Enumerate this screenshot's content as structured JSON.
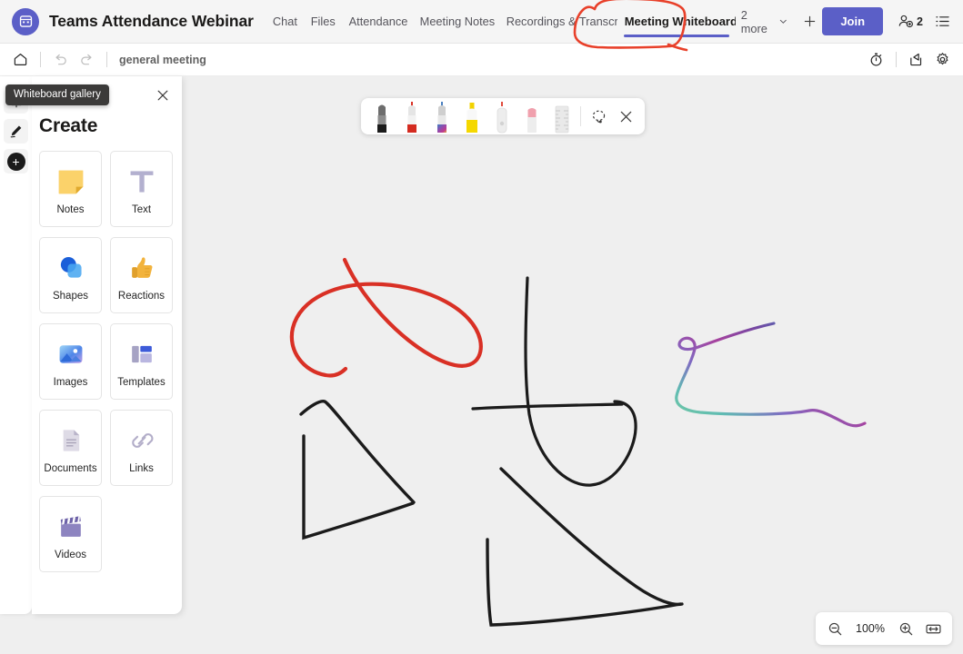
{
  "header": {
    "app_icon": "teams-calendar-icon",
    "title": "Teams Attendance Webinar",
    "tabs": [
      {
        "label": "Chat",
        "active": false
      },
      {
        "label": "Files",
        "active": false
      },
      {
        "label": "Attendance",
        "active": false
      },
      {
        "label": "Meeting Notes",
        "active": false
      },
      {
        "label": "Recordings & Transcr...",
        "active": false
      },
      {
        "label": "Meeting Whiteboard",
        "active": true
      }
    ],
    "more_label": "2 more",
    "add_tab_label": "+",
    "join_label": "Join",
    "people_count": "2",
    "accent_color": "#5b5fc7",
    "annotation_color": "#e8402a"
  },
  "subbar": {
    "home_icon": "home-icon",
    "undo_icon": "undo-icon",
    "redo_icon": "redo-icon",
    "board_name": "general meeting",
    "timer_icon": "timer-icon",
    "share_icon": "share-icon",
    "settings_icon": "settings-gear-icon"
  },
  "rail": {
    "tooltip": "Whiteboard gallery",
    "items": [
      {
        "name": "gallery-button",
        "icon": "whiteboard-gallery-icon"
      },
      {
        "name": "ink-button",
        "icon": "pen-icon"
      },
      {
        "name": "create-button",
        "icon": "plus-icon"
      }
    ]
  },
  "panel": {
    "title": "Create",
    "close_label": "✕",
    "cards": [
      {
        "label": "Notes",
        "icon": "sticky-note-icon"
      },
      {
        "label": "Text",
        "icon": "text-t-icon"
      },
      {
        "label": "Shapes",
        "icon": "shapes-icon"
      },
      {
        "label": "Reactions",
        "icon": "thumbs-up-icon"
      },
      {
        "label": "Images",
        "icon": "image-icon"
      },
      {
        "label": "Templates",
        "icon": "templates-icon"
      },
      {
        "label": "Documents",
        "icon": "document-icon"
      },
      {
        "label": "Links",
        "icon": "link-chain-icon"
      },
      {
        "label": "Videos",
        "icon": "video-clapperboard-icon"
      }
    ]
  },
  "pen_toolbar": {
    "tools": [
      {
        "name": "black-pen",
        "color": "#1b1b1b"
      },
      {
        "name": "red-pen",
        "color": "#d93025"
      },
      {
        "name": "galaxy-pen",
        "color": "#7b4fb5"
      },
      {
        "name": "yellow-highlighter",
        "color": "#f2d200"
      },
      {
        "name": "eraser",
        "color": "#d8d8d8"
      },
      {
        "name": "pink-marker",
        "color": "#f0a0ad"
      },
      {
        "name": "ruler",
        "color": "#dcdcdc"
      }
    ],
    "lasso_icon": "lasso-select-icon",
    "close_icon": "close-icon"
  },
  "zoom_controls": {
    "zoom_out_icon": "zoom-out-icon",
    "value": "100%",
    "zoom_in_icon": "zoom-in-icon",
    "fit_icon": "fit-to-screen-icon"
  },
  "canvas": {
    "background": "#efefef",
    "strokes": [
      {
        "name": "red-loop-stroke",
        "color": "#d93025"
      },
      {
        "name": "black-triangle-stroke",
        "color": "#1b1b1b"
      },
      {
        "name": "black-hook-stroke",
        "color": "#1b1b1b"
      },
      {
        "name": "black-large-triangle-stroke",
        "color": "#1b1b1b"
      },
      {
        "name": "galaxy-gradient-stroke",
        "color": "gradient-green-purple-blue"
      }
    ]
  }
}
